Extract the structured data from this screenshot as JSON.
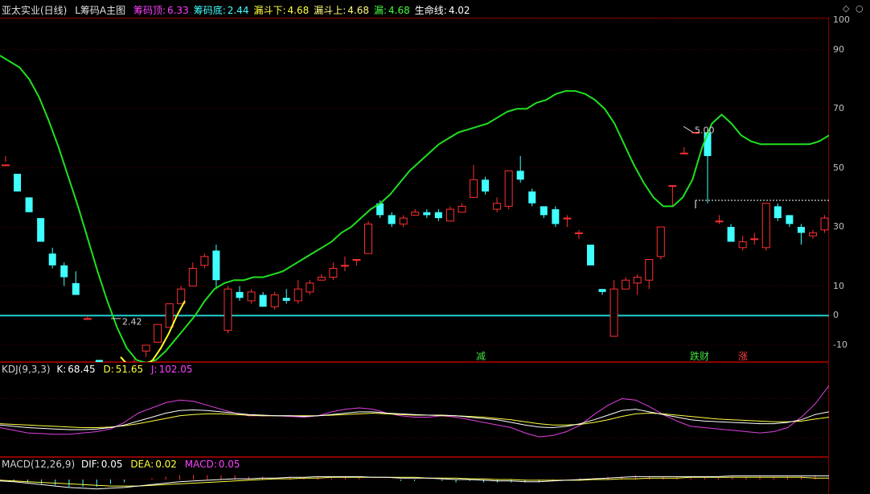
{
  "header": {
    "stock_name": "亚太实业(日线)",
    "indicator_name": "L筹码A主图",
    "fields": [
      {
        "label": "筹码顶:",
        "value": "6.33",
        "color": "#ff40ff"
      },
      {
        "label": "筹码底:",
        "value": "2.44",
        "color": "#40ffff"
      },
      {
        "label": "漏斗下:",
        "value": "4.68",
        "color": "#ffff40"
      },
      {
        "label": "漏斗上:",
        "value": "4.68",
        "color": "#ffff80"
      },
      {
        "label": "漏:",
        "value": "4.68",
        "color": "#40ff40"
      },
      {
        "label": "生命线:",
        "value": "4.02",
        "color": "#ffffff"
      }
    ]
  },
  "main_axis": {
    "ticks": [
      "100",
      "90",
      "70",
      "50",
      "30",
      "10",
      "0",
      "-10"
    ]
  },
  "annotations": {
    "high_label": "5.00",
    "low_label": "2.42",
    "signal_jian": "减",
    "signal_diecai": "跌财",
    "signal_zhang": "涨"
  },
  "kdj": {
    "title": "KDJ(9,3,3)",
    "k_label": "K:",
    "k_value": "68.45",
    "d_label": "D:",
    "d_value": "51.65",
    "j_label": "J:",
    "j_value": "102.05"
  },
  "macd": {
    "title": "MACD(12,26,9)",
    "dif_label": "DIF:",
    "dif_value": "0.05",
    "dea_label": "DEA:",
    "dea_value": "0.02",
    "macd_label": "MACD:",
    "macd_value": "0.05"
  },
  "controls": {
    "settings_glyph": "◇",
    "close_glyph": "○"
  },
  "colors": {
    "up": "#ff3030",
    "down": "#40ffff",
    "life_line": "#20e020",
    "funnel": "#ffff20",
    "base_line": "#20d0d0",
    "k": "#ffffff",
    "d": "#ffff40",
    "j": "#e040e0"
  },
  "chart_data": {
    "type": "candlestick",
    "candles": [
      [
        51.0,
        51.0,
        54.0,
        52.0
      ],
      [
        48.0,
        42.0,
        48.0,
        42.0
      ],
      [
        40.0,
        35.0,
        40.0,
        35.0
      ],
      [
        33.0,
        25.0,
        33.0,
        25.0
      ],
      [
        21.0,
        17.0,
        23.0,
        16.0
      ],
      [
        17.0,
        13.0,
        18.0,
        10.0
      ],
      [
        11.0,
        7.0,
        15.0,
        7.0
      ],
      [
        -1.0,
        -1.0,
        0.0,
        -1.0
      ],
      [
        -15.0,
        -22.0,
        -15.0,
        -22.0
      ],
      [
        -31.0,
        -23.0,
        -22.0,
        -32.0
      ],
      [
        -25.0,
        -20.0,
        -19.0,
        -29.0
      ],
      [
        -18.0,
        -16.0,
        -14.0,
        -20.0
      ],
      [
        -12.0,
        -10.0,
        -10.0,
        -14.0
      ],
      [
        -9.0,
        -3.0,
        -3.0,
        -9.0
      ],
      [
        -4.0,
        4.0,
        4.0,
        -4.0
      ],
      [
        4.0,
        9.0,
        10.0,
        4.0
      ],
      [
        10.0,
        16.0,
        18.0,
        10.0
      ],
      [
        17.0,
        20.0,
        21.0,
        16.0
      ],
      [
        22.0,
        12.0,
        24.0,
        9.0
      ],
      [
        -5.0,
        9.0,
        10.0,
        -6.0
      ],
      [
        8.0,
        6.0,
        10.0,
        5.0
      ],
      [
        5.0,
        8.0,
        9.0,
        4.0
      ],
      [
        7.0,
        3.0,
        8.0,
        3.0
      ],
      [
        3.0,
        7.0,
        8.0,
        2.0
      ],
      [
        6.0,
        5.0,
        9.0,
        4.0
      ],
      [
        5.0,
        9.0,
        12.0,
        4.0
      ],
      [
        8.0,
        11.0,
        12.0,
        7.0
      ],
      [
        12.0,
        13.0,
        14.0,
        12.0
      ],
      [
        13.0,
        16.0,
        18.0,
        12.0
      ],
      [
        17.0,
        17.0,
        20.0,
        15.0
      ],
      [
        19.0,
        19.0,
        19.0,
        17.0
      ],
      [
        21.0,
        31.0,
        32.0,
        21.0
      ],
      [
        38.0,
        34.0,
        39.0,
        33.0
      ],
      [
        34.0,
        31.0,
        35.0,
        30.0
      ],
      [
        31.0,
        33.0,
        34.0,
        30.0
      ],
      [
        34.0,
        35.0,
        36.0,
        34.0
      ],
      [
        35.0,
        34.0,
        36.0,
        33.0
      ],
      [
        35.0,
        33.0,
        36.0,
        32.0
      ],
      [
        32.0,
        36.0,
        37.0,
        32.0
      ],
      [
        35.0,
        37.0,
        38.0,
        35.0
      ],
      [
        40.0,
        46.0,
        51.0,
        40.0
      ],
      [
        46.0,
        42.0,
        47.0,
        41.0
      ],
      [
        36.0,
        38.0,
        40.0,
        35.0
      ],
      [
        37.0,
        49.0,
        49.0,
        36.0
      ],
      [
        49.0,
        46.0,
        54.0,
        45.0
      ],
      [
        42.0,
        38.0,
        43.0,
        37.0
      ],
      [
        37.0,
        34.0,
        37.0,
        33.0
      ],
      [
        36.0,
        31.0,
        37.0,
        30.0
      ],
      [
        33.0,
        33.0,
        34.0,
        30.0
      ],
      [
        28.0,
        28.0,
        29.0,
        26.0
      ],
      [
        24.0,
        17.0,
        24.0,
        17.0
      ],
      [
        9.0,
        8.0,
        9.0,
        7.0
      ],
      [
        -7.0,
        9.0,
        12.0,
        -7.0
      ],
      [
        9.0,
        12.0,
        13.0,
        9.0
      ],
      [
        11.0,
        13.0,
        14.0,
        7.0
      ],
      [
        12.0,
        19.0,
        19.0,
        9.0
      ],
      [
        20.0,
        30.0,
        30.0,
        19.0
      ],
      [
        44.0,
        44.0,
        44.0,
        37.0
      ],
      [
        55.0,
        55.0,
        57.0,
        55.0
      ],
      [
        62.0,
        62.0,
        62.0,
        62.0
      ],
      [
        62.0,
        54.0,
        63.0,
        38.0
      ],
      [
        32.0,
        32.0,
        34.0,
        31.0
      ],
      [
        30.0,
        25.0,
        31.0,
        25.0
      ],
      [
        23.0,
        25.0,
        27.0,
        22.0
      ],
      [
        26.0,
        26.0,
        28.0,
        24.0
      ],
      [
        23.0,
        38.0,
        38.0,
        22.0
      ],
      [
        37.0,
        33.0,
        38.0,
        32.0
      ],
      [
        34.0,
        31.0,
        34.0,
        30.0
      ],
      [
        30.0,
        28.0,
        31.0,
        24.0
      ],
      [
        27.0,
        28.0,
        29.0,
        26.0
      ],
      [
        29.0,
        33.0,
        34.0,
        28.0
      ],
      [
        31.0,
        35.0,
        39.0,
        30.0
      ],
      [
        34.0,
        38.0,
        38.0,
        30.0
      ],
      [
        38.0,
        44.0,
        44.0,
        37.0
      ]
    ],
    "life_line": [
      88,
      86,
      84,
      80,
      74,
      66,
      57,
      47,
      37,
      26,
      15,
      5,
      -4,
      -11,
      -15,
      -16,
      -15,
      -12,
      -8,
      -4,
      0,
      5,
      9,
      11,
      12,
      12,
      13,
      13,
      14,
      15,
      17,
      19,
      21,
      23,
      25,
      28,
      30,
      33,
      36,
      38,
      41,
      45,
      49,
      52,
      55,
      58,
      60,
      62,
      63,
      64,
      65,
      67,
      69,
      70,
      70,
      72,
      73,
      75,
      76,
      76,
      75,
      73,
      70,
      65,
      58,
      51,
      45,
      40,
      37,
      37,
      40,
      46,
      57,
      65,
      68,
      65,
      61,
      59,
      58,
      58,
      58,
      58,
      58,
      58,
      59,
      61
    ],
    "funnel_line": [
      -14,
      -17,
      -18,
      -17,
      -15,
      -11,
      -6,
      0,
      5
    ],
    "cost_base": 2.42,
    "cost_base_axis_value": 0,
    "resistance_level": 5.0,
    "resistance_axis_value": 39,
    "main_ylim": [
      -10,
      100
    ],
    "kdj_series": {
      "K": [
        40,
        38,
        36,
        35,
        34,
        33,
        33,
        34,
        36,
        40,
        46,
        52,
        58,
        62,
        63,
        62,
        60,
        58,
        56,
        55,
        54,
        54,
        53,
        54,
        56,
        58,
        60,
        60,
        58,
        57,
        56,
        55,
        55,
        54,
        52,
        50,
        48,
        44,
        40,
        37,
        36,
        38,
        42,
        48,
        55,
        62,
        64,
        60,
        56,
        52,
        48,
        46,
        45,
        44,
        43,
        42,
        42,
        44,
        48,
        56,
        60
      ],
      "D": [
        42,
        41,
        40,
        39,
        38,
        37,
        36,
        36,
        37,
        39,
        42,
        46,
        50,
        54,
        56,
        57,
        57,
        56,
        55,
        54,
        54,
        54,
        54,
        54,
        55,
        56,
        57,
        58,
        57,
        56,
        55,
        55,
        54,
        54,
        53,
        52,
        50,
        48,
        45,
        42,
        40,
        40,
        41,
        44,
        48,
        53,
        57,
        58,
        57,
        55,
        53,
        51,
        49,
        48,
        47,
        46,
        45,
        45,
        46,
        49,
        52
      ],
      "J": [
        36,
        32,
        28,
        27,
        26,
        26,
        28,
        30,
        34,
        44,
        58,
        66,
        74,
        78,
        76,
        70,
        64,
        58,
        54,
        54,
        54,
        53,
        52,
        54,
        60,
        64,
        66,
        64,
        58,
        54,
        52,
        52,
        54,
        52,
        48,
        44,
        40,
        36,
        28,
        22,
        24,
        30,
        40,
        56,
        70,
        80,
        78,
        68,
        56,
        46,
        38,
        36,
        34,
        32,
        30,
        28,
        30,
        36,
        52,
        72,
        100
      ]
    },
    "macd_series": {
      "DIF": [
        -0.02,
        -0.03,
        -0.05,
        -0.07,
        -0.09,
        -0.11,
        -0.12,
        -0.13,
        -0.12,
        -0.11,
        -0.09,
        -0.07,
        -0.05,
        -0.03,
        -0.02,
        -0.01,
        0.0,
        0.01,
        0.01,
        0.02,
        0.02,
        0.03,
        0.03,
        0.04,
        0.04,
        0.04,
        0.04,
        0.03,
        0.03,
        0.02,
        0.02,
        0.02,
        0.01,
        0.0,
        0.0,
        -0.01,
        -0.02,
        -0.02,
        -0.03,
        -0.03,
        -0.02,
        -0.01,
        0.0,
        0.01,
        0.02,
        0.03,
        0.04,
        0.04,
        0.04,
        0.04,
        0.04,
        0.04,
        0.04,
        0.05,
        0.05,
        0.05,
        0.05,
        0.05,
        0.05,
        0.05,
        0.05
      ],
      "DEA": [
        -0.01,
        -0.02,
        -0.03,
        -0.04,
        -0.05,
        -0.06,
        -0.07,
        -0.08,
        -0.09,
        -0.09,
        -0.09,
        -0.08,
        -0.07,
        -0.06,
        -0.05,
        -0.04,
        -0.03,
        -0.02,
        -0.01,
        0.0,
        0.01,
        0.01,
        0.02,
        0.02,
        0.03,
        0.03,
        0.03,
        0.03,
        0.03,
        0.03,
        0.03,
        0.02,
        0.02,
        0.02,
        0.01,
        0.01,
        0.0,
        0.0,
        -0.01,
        -0.01,
        -0.01,
        -0.01,
        -0.01,
        0.0,
        0.0,
        0.01,
        0.01,
        0.02,
        0.02,
        0.02,
        0.03,
        0.03,
        0.03,
        0.03,
        0.03,
        0.03,
        0.03,
        0.03,
        0.03,
        0.02,
        0.02
      ]
    }
  }
}
